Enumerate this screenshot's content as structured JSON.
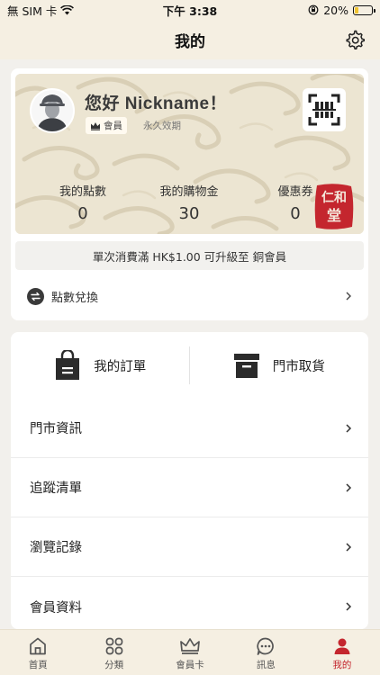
{
  "status_bar": {
    "carrier": "無 SIM 卡",
    "time": "下午 3:38",
    "battery": "20%",
    "battery_level": 0.2
  },
  "header": {
    "title": "我的"
  },
  "profile": {
    "greeting": "您好 Nickname！",
    "tier": "會員",
    "validity": "永久效期",
    "stats": [
      {
        "label": "我的點數",
        "value": "0"
      },
      {
        "label": "我的購物金",
        "value": "30"
      },
      {
        "label": "優惠券",
        "value": "0"
      }
    ],
    "seal_text": "仁和堂"
  },
  "upgrade_text": "單次消費滿 HK$1.00 可升級至 銅會員",
  "points_exchange": "點數兌換",
  "quick_actions": [
    {
      "label": "我的訂單",
      "icon": "shopping-bag-icon"
    },
    {
      "label": "門市取貨",
      "icon": "box-icon"
    }
  ],
  "menu": [
    {
      "label": "門市資訊"
    },
    {
      "label": "追蹤清單"
    },
    {
      "label": "瀏覽記錄"
    },
    {
      "label": "會員資料"
    }
  ],
  "tabs": [
    {
      "label": "首頁",
      "icon": "home-icon"
    },
    {
      "label": "分類",
      "icon": "grid-icon"
    },
    {
      "label": "會員卡",
      "icon": "crown-icon"
    },
    {
      "label": "訊息",
      "icon": "chat-icon"
    },
    {
      "label": "我的",
      "icon": "person-icon",
      "active": true
    }
  ],
  "colors": {
    "accent": "#c4262e",
    "header_bg": "#f5efe2",
    "card_pattern_bg": "#ece5d2"
  }
}
